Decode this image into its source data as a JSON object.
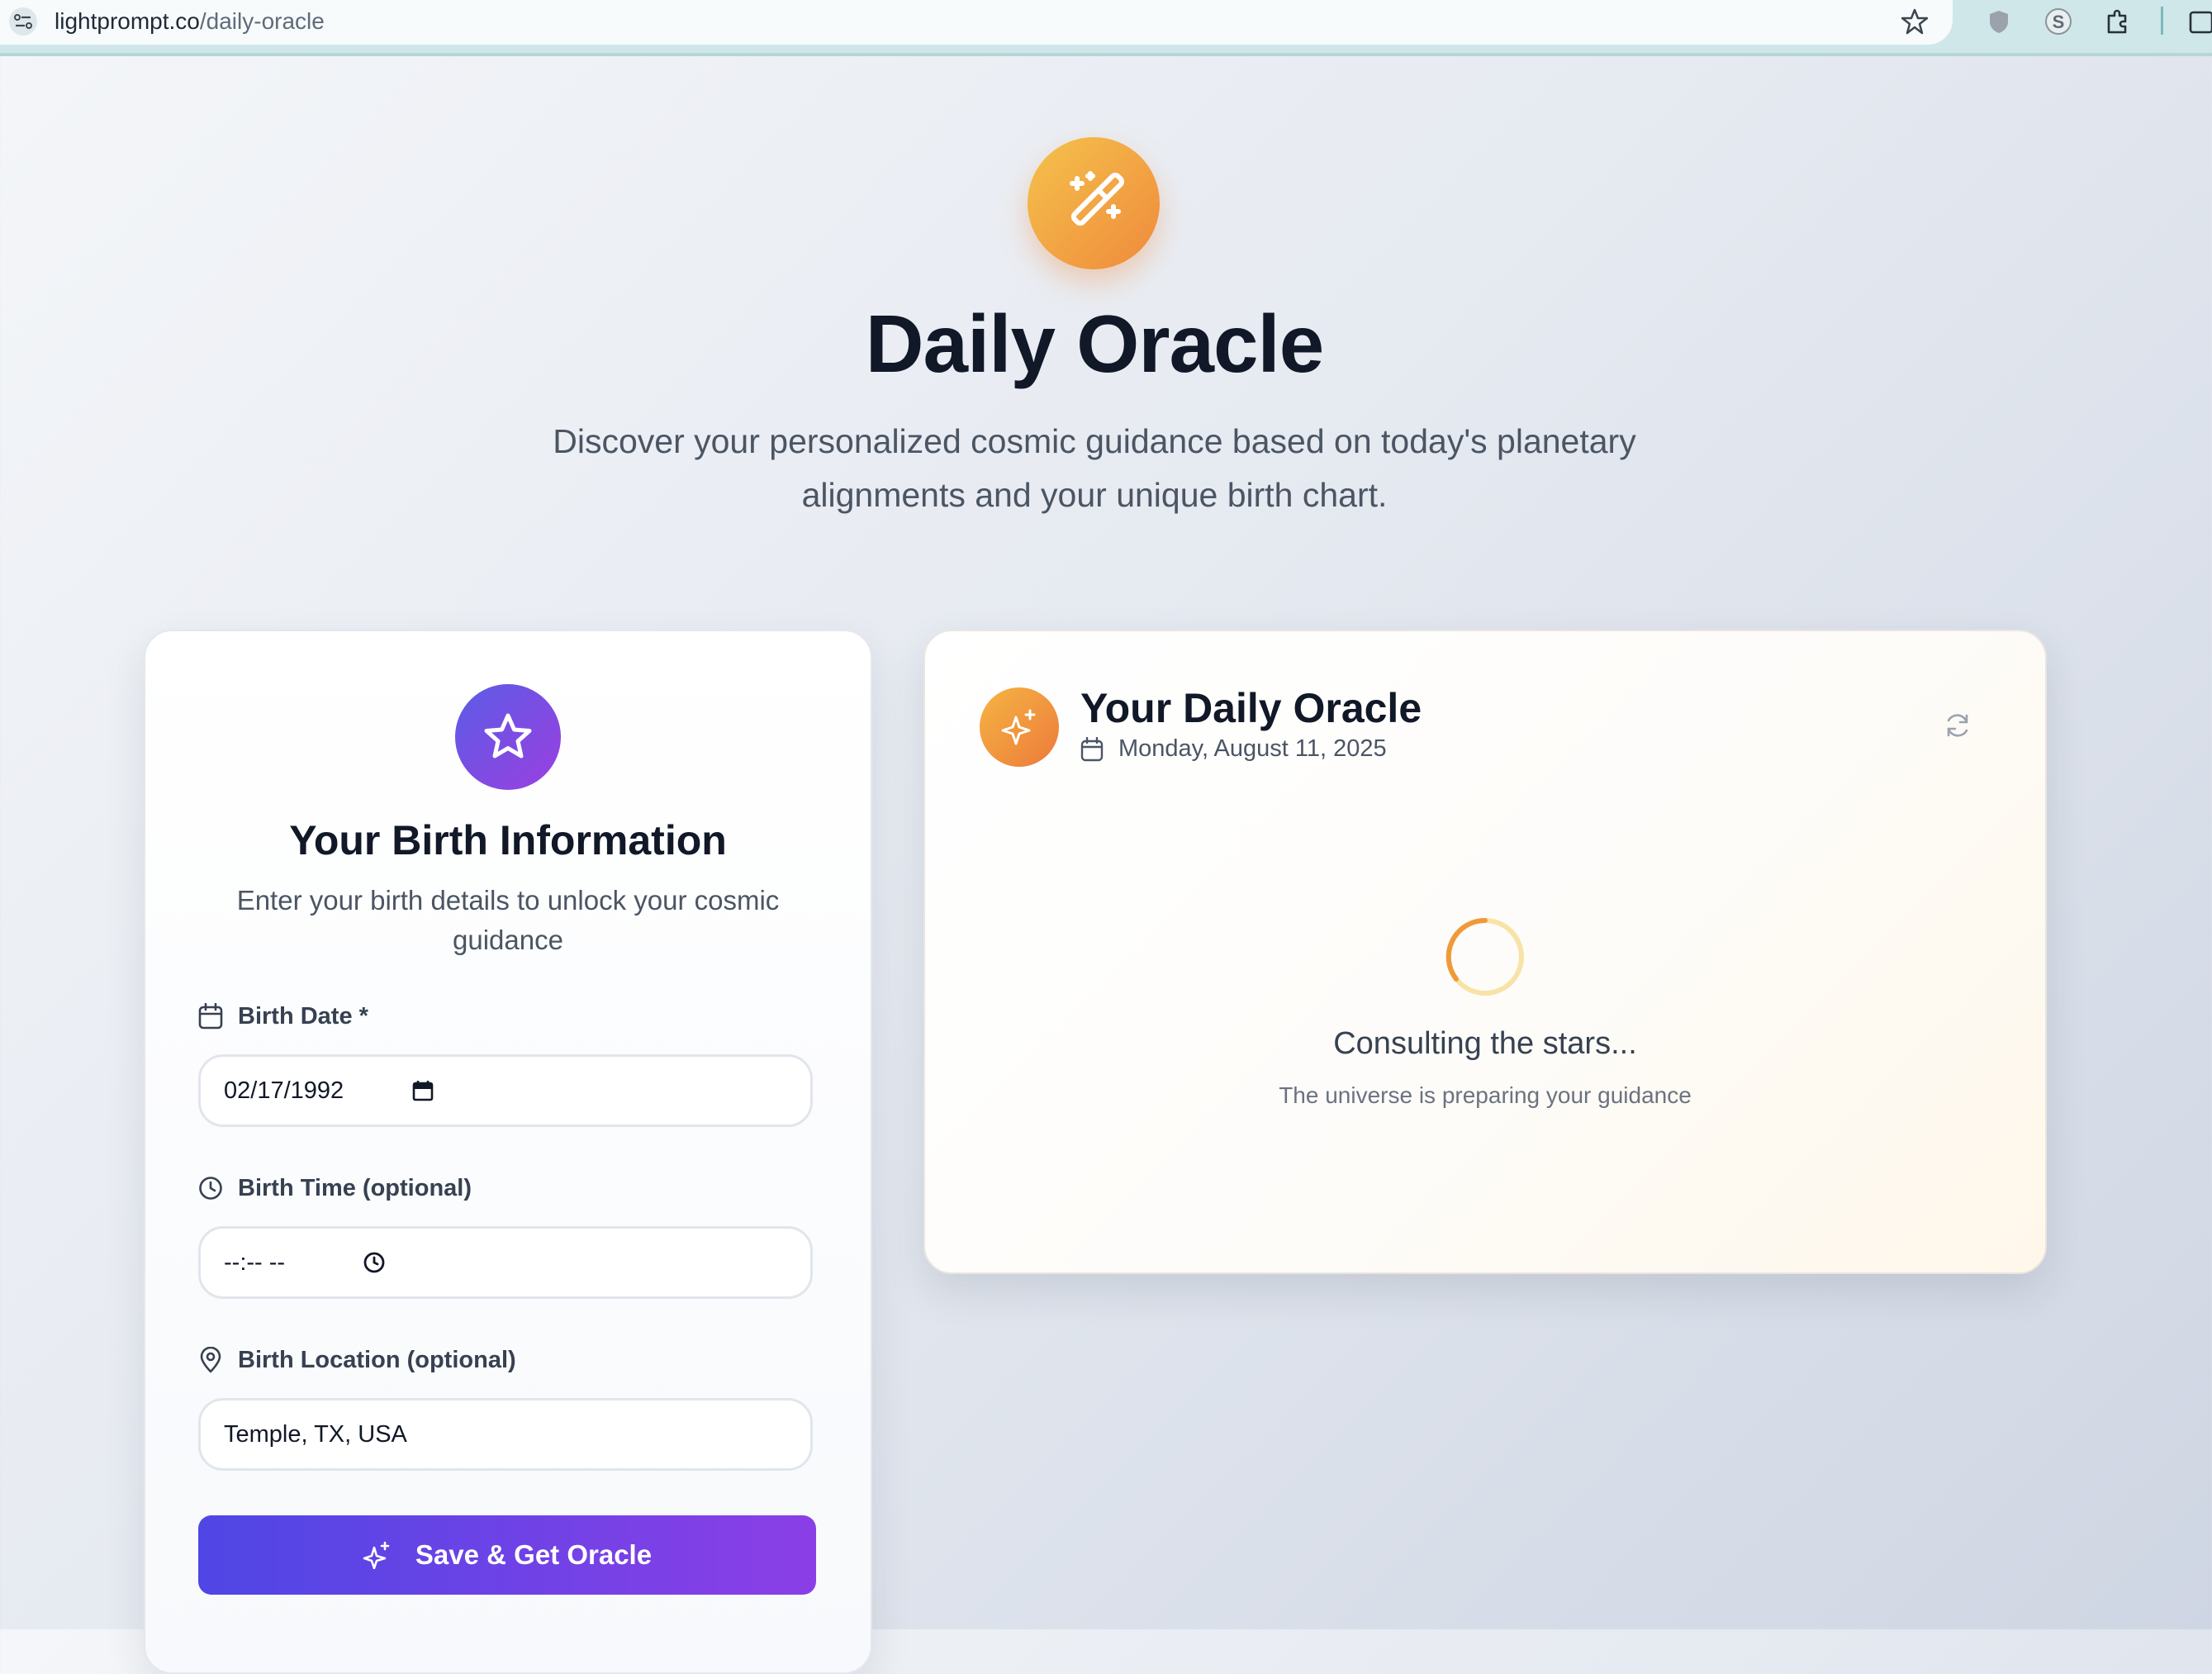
{
  "browser": {
    "url_host": "lightprompt.co",
    "url_path": "/daily-oracle"
  },
  "hero": {
    "icon": "magic-wand-icon",
    "title": "Daily Oracle",
    "subtitle": "Discover your personalized cosmic guidance based on today's planetary alignments and your unique birth chart."
  },
  "birth_form": {
    "icon": "star-icon",
    "title": "Your Birth Information",
    "description": "Enter your birth details to unlock your cosmic guidance",
    "birth_date_label": "Birth Date *",
    "birth_date_value": "02/17/1992",
    "birth_time_label": "Birth Time (optional)",
    "birth_time_value": "--:-- --",
    "birth_location_label": "Birth Location (optional)",
    "birth_location_value": "Temple, TX, USA",
    "submit_label": "Save & Get Oracle"
  },
  "oracle": {
    "icon": "sparkles-icon",
    "title": "Your Daily Oracle",
    "date": "Monday, August 11, 2025",
    "loading_title": "Consulting the stars...",
    "loading_subtitle": "The universe is preparing your guidance"
  },
  "colors": {
    "accent_orange": "#ef8a3c",
    "accent_purple": "#7c3aed",
    "button_gradient_start": "#4f46e5",
    "button_gradient_end": "#8b3fe6"
  }
}
